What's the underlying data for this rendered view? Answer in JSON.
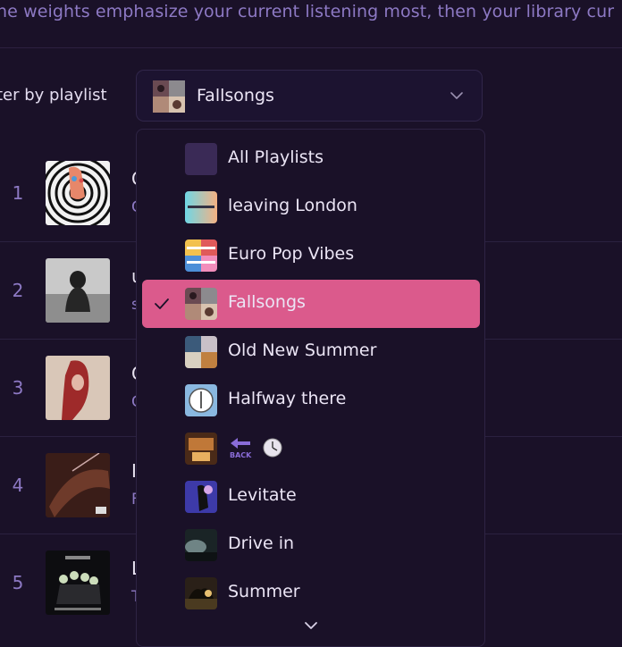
{
  "header": {
    "description": "he weights emphasize your current listening most, then your library cur"
  },
  "filter": {
    "label": "ter by playlist",
    "selected": "Fallsongs"
  },
  "tracks": [
    {
      "rank": "1",
      "title": "C",
      "subtitle": "C"
    },
    {
      "rank": "2",
      "title": "u",
      "subtitle": "s"
    },
    {
      "rank": "3",
      "title": "C",
      "subtitle": "C"
    },
    {
      "rank": "4",
      "title": "I",
      "subtitle": "F"
    },
    {
      "rank": "5",
      "title": "L",
      "subtitle": "T"
    }
  ],
  "dropdown": {
    "options": [
      {
        "label": "All Playlists",
        "icon": "blank-thumbnail"
      },
      {
        "label": "leaving London",
        "icon": "gradient-thumbnail"
      },
      {
        "label": "Euro Pop Vibes",
        "icon": "collage-thumbnail"
      },
      {
        "label": "Fallsongs",
        "icon": "collage-thumbnail",
        "selected": true
      },
      {
        "label": "Old New Summer",
        "icon": "collage-thumbnail"
      },
      {
        "label": "Halfway there",
        "icon": "clock-thumbnail"
      },
      {
        "label": "",
        "icon": "back-and-clock-emoji"
      },
      {
        "label": "Levitate",
        "icon": "photo-thumbnail"
      },
      {
        "label": "Drive in",
        "icon": "photo-thumbnail"
      },
      {
        "label": "Summer",
        "icon": "photo-thumbnail"
      }
    ]
  },
  "colors": {
    "background": "#1a1128",
    "accent_text": "#8d79c4",
    "selected_option": "#db5a8c",
    "border": "#2e2444"
  }
}
